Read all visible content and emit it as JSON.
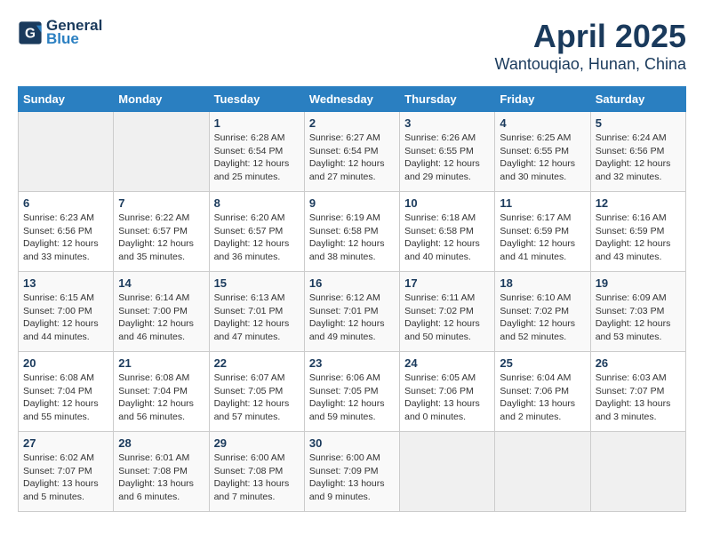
{
  "header": {
    "logo_line1": "General",
    "logo_line2": "Blue",
    "month": "April 2025",
    "location": "Wantouqiao, Hunan, China"
  },
  "weekdays": [
    "Sunday",
    "Monday",
    "Tuesday",
    "Wednesday",
    "Thursday",
    "Friday",
    "Saturday"
  ],
  "weeks": [
    [
      {
        "day": "",
        "text": ""
      },
      {
        "day": "",
        "text": ""
      },
      {
        "day": "1",
        "text": "Sunrise: 6:28 AM\nSunset: 6:54 PM\nDaylight: 12 hours\nand 25 minutes."
      },
      {
        "day": "2",
        "text": "Sunrise: 6:27 AM\nSunset: 6:54 PM\nDaylight: 12 hours\nand 27 minutes."
      },
      {
        "day": "3",
        "text": "Sunrise: 6:26 AM\nSunset: 6:55 PM\nDaylight: 12 hours\nand 29 minutes."
      },
      {
        "day": "4",
        "text": "Sunrise: 6:25 AM\nSunset: 6:55 PM\nDaylight: 12 hours\nand 30 minutes."
      },
      {
        "day": "5",
        "text": "Sunrise: 6:24 AM\nSunset: 6:56 PM\nDaylight: 12 hours\nand 32 minutes."
      }
    ],
    [
      {
        "day": "6",
        "text": "Sunrise: 6:23 AM\nSunset: 6:56 PM\nDaylight: 12 hours\nand 33 minutes."
      },
      {
        "day": "7",
        "text": "Sunrise: 6:22 AM\nSunset: 6:57 PM\nDaylight: 12 hours\nand 35 minutes."
      },
      {
        "day": "8",
        "text": "Sunrise: 6:20 AM\nSunset: 6:57 PM\nDaylight: 12 hours\nand 36 minutes."
      },
      {
        "day": "9",
        "text": "Sunrise: 6:19 AM\nSunset: 6:58 PM\nDaylight: 12 hours\nand 38 minutes."
      },
      {
        "day": "10",
        "text": "Sunrise: 6:18 AM\nSunset: 6:58 PM\nDaylight: 12 hours\nand 40 minutes."
      },
      {
        "day": "11",
        "text": "Sunrise: 6:17 AM\nSunset: 6:59 PM\nDaylight: 12 hours\nand 41 minutes."
      },
      {
        "day": "12",
        "text": "Sunrise: 6:16 AM\nSunset: 6:59 PM\nDaylight: 12 hours\nand 43 minutes."
      }
    ],
    [
      {
        "day": "13",
        "text": "Sunrise: 6:15 AM\nSunset: 7:00 PM\nDaylight: 12 hours\nand 44 minutes."
      },
      {
        "day": "14",
        "text": "Sunrise: 6:14 AM\nSunset: 7:00 PM\nDaylight: 12 hours\nand 46 minutes."
      },
      {
        "day": "15",
        "text": "Sunrise: 6:13 AM\nSunset: 7:01 PM\nDaylight: 12 hours\nand 47 minutes."
      },
      {
        "day": "16",
        "text": "Sunrise: 6:12 AM\nSunset: 7:01 PM\nDaylight: 12 hours\nand 49 minutes."
      },
      {
        "day": "17",
        "text": "Sunrise: 6:11 AM\nSunset: 7:02 PM\nDaylight: 12 hours\nand 50 minutes."
      },
      {
        "day": "18",
        "text": "Sunrise: 6:10 AM\nSunset: 7:02 PM\nDaylight: 12 hours\nand 52 minutes."
      },
      {
        "day": "19",
        "text": "Sunrise: 6:09 AM\nSunset: 7:03 PM\nDaylight: 12 hours\nand 53 minutes."
      }
    ],
    [
      {
        "day": "20",
        "text": "Sunrise: 6:08 AM\nSunset: 7:04 PM\nDaylight: 12 hours\nand 55 minutes."
      },
      {
        "day": "21",
        "text": "Sunrise: 6:08 AM\nSunset: 7:04 PM\nDaylight: 12 hours\nand 56 minutes."
      },
      {
        "day": "22",
        "text": "Sunrise: 6:07 AM\nSunset: 7:05 PM\nDaylight: 12 hours\nand 57 minutes."
      },
      {
        "day": "23",
        "text": "Sunrise: 6:06 AM\nSunset: 7:05 PM\nDaylight: 12 hours\nand 59 minutes."
      },
      {
        "day": "24",
        "text": "Sunrise: 6:05 AM\nSunset: 7:06 PM\nDaylight: 13 hours\nand 0 minutes."
      },
      {
        "day": "25",
        "text": "Sunrise: 6:04 AM\nSunset: 7:06 PM\nDaylight: 13 hours\nand 2 minutes."
      },
      {
        "day": "26",
        "text": "Sunrise: 6:03 AM\nSunset: 7:07 PM\nDaylight: 13 hours\nand 3 minutes."
      }
    ],
    [
      {
        "day": "27",
        "text": "Sunrise: 6:02 AM\nSunset: 7:07 PM\nDaylight: 13 hours\nand 5 minutes."
      },
      {
        "day": "28",
        "text": "Sunrise: 6:01 AM\nSunset: 7:08 PM\nDaylight: 13 hours\nand 6 minutes."
      },
      {
        "day": "29",
        "text": "Sunrise: 6:00 AM\nSunset: 7:08 PM\nDaylight: 13 hours\nand 7 minutes."
      },
      {
        "day": "30",
        "text": "Sunrise: 6:00 AM\nSunset: 7:09 PM\nDaylight: 13 hours\nand 9 minutes."
      },
      {
        "day": "",
        "text": ""
      },
      {
        "day": "",
        "text": ""
      },
      {
        "day": "",
        "text": ""
      }
    ]
  ]
}
